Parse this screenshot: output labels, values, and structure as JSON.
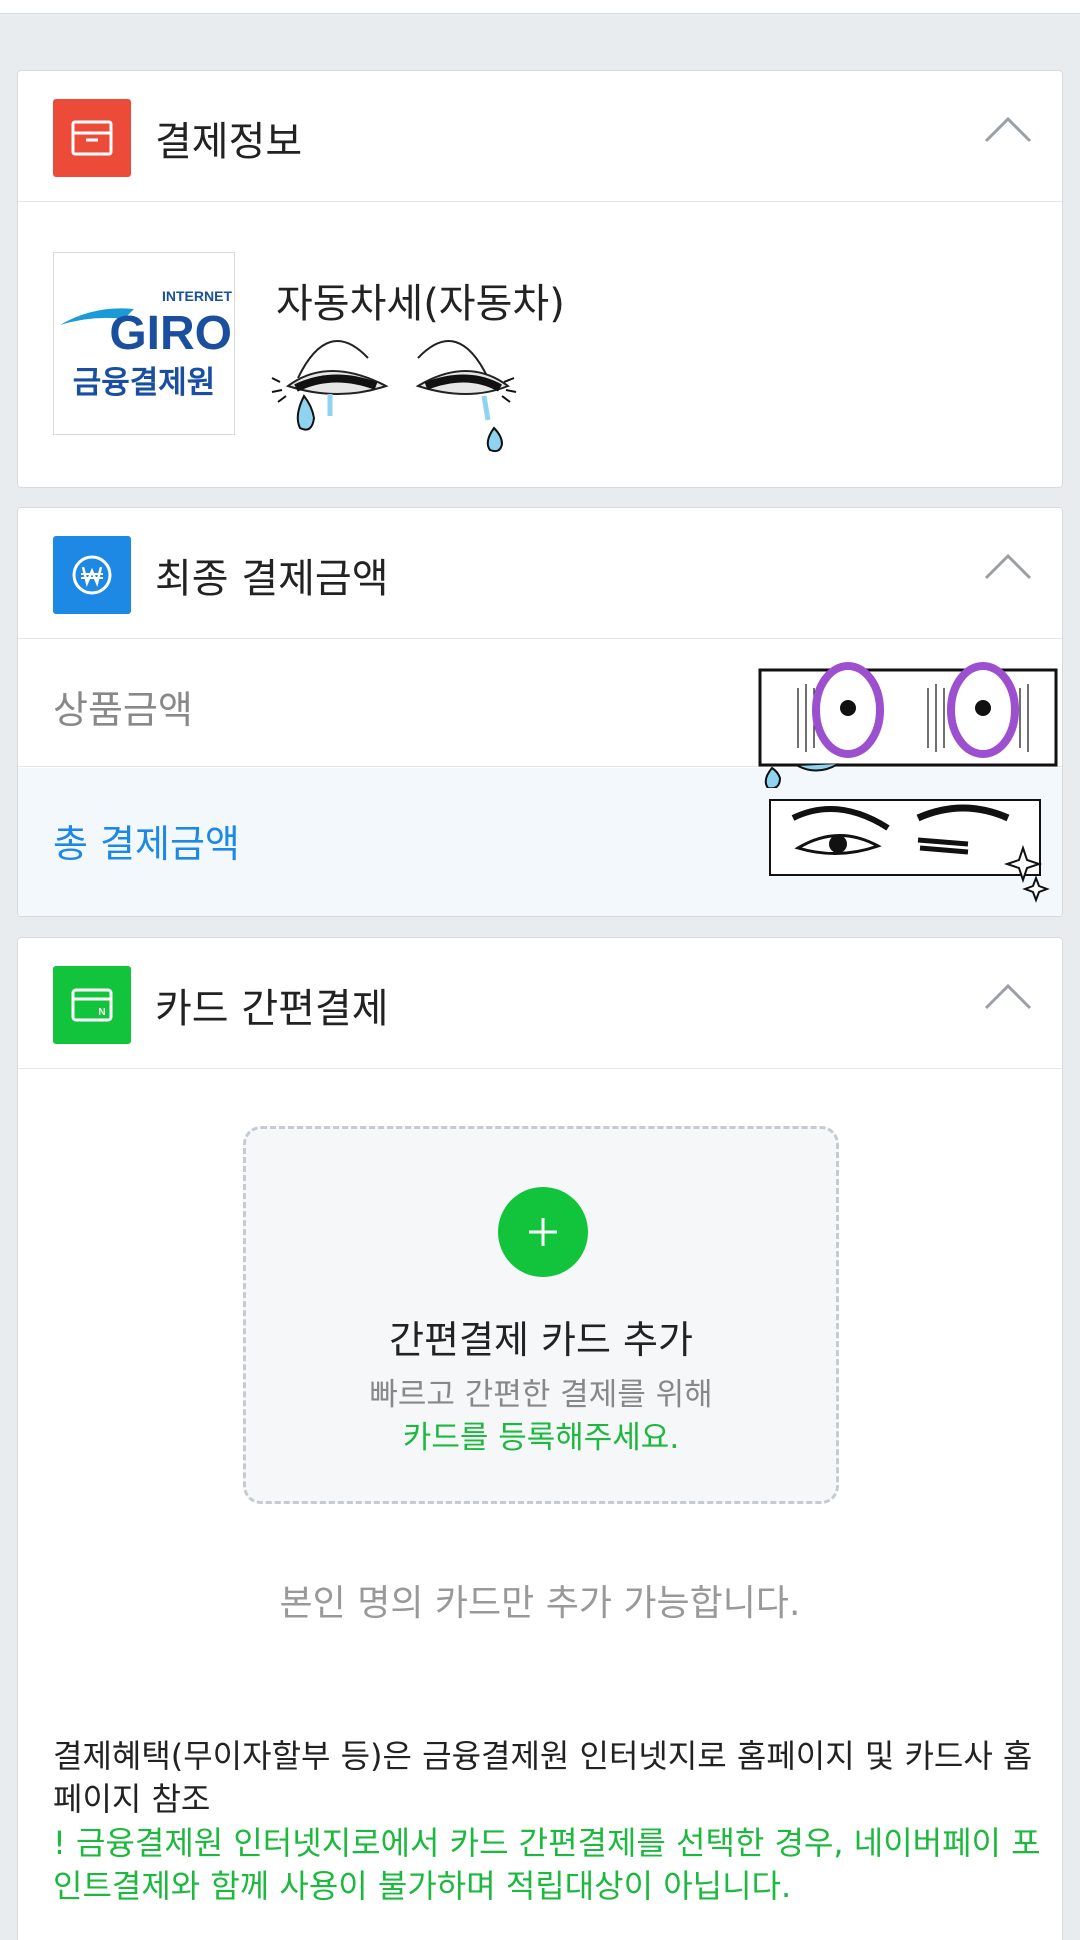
{
  "colors": {
    "payinfo_badge": "#ec4b3a",
    "amount_badge": "#1e88e5",
    "simple_badge": "#12c43c",
    "accent_green": "#1db83e",
    "accent_blue": "#1e88e5"
  },
  "payinfo": {
    "title": "결제정보",
    "icon": "box-icon",
    "logo": {
      "top_text": "INTERNET",
      "brand": "GIRO",
      "sub_text": "금융결제원"
    },
    "product_name": "자동차세(자동차)"
  },
  "amount": {
    "title": "최종 결제금액",
    "icon": "won-icon",
    "subtotal_label": "상품금액",
    "total_label": "총 결제금액"
  },
  "simple_pay": {
    "title": "카드 간편결제",
    "icon": "card-icon",
    "add_title": "간편결제 카드 추가",
    "add_sub1": "빠르고 간편한 결제를 위해",
    "add_sub2": "카드를 등록해주세요.",
    "own_card_note": "본인 명의 카드만 추가 가능합니다.",
    "benefit_note": "결제혜택(무이자할부 등)은 금융결제원 인터넷지로 홈페이지 및 카드사 홈페이지 참조",
    "warning_note": "! 금융결제원 인터넷지로에서 카드 간편결제를 선택한 경우, 네이버페이 포인트결제와 함께 사용이 불가하며 적립대상이 아닙니다."
  }
}
